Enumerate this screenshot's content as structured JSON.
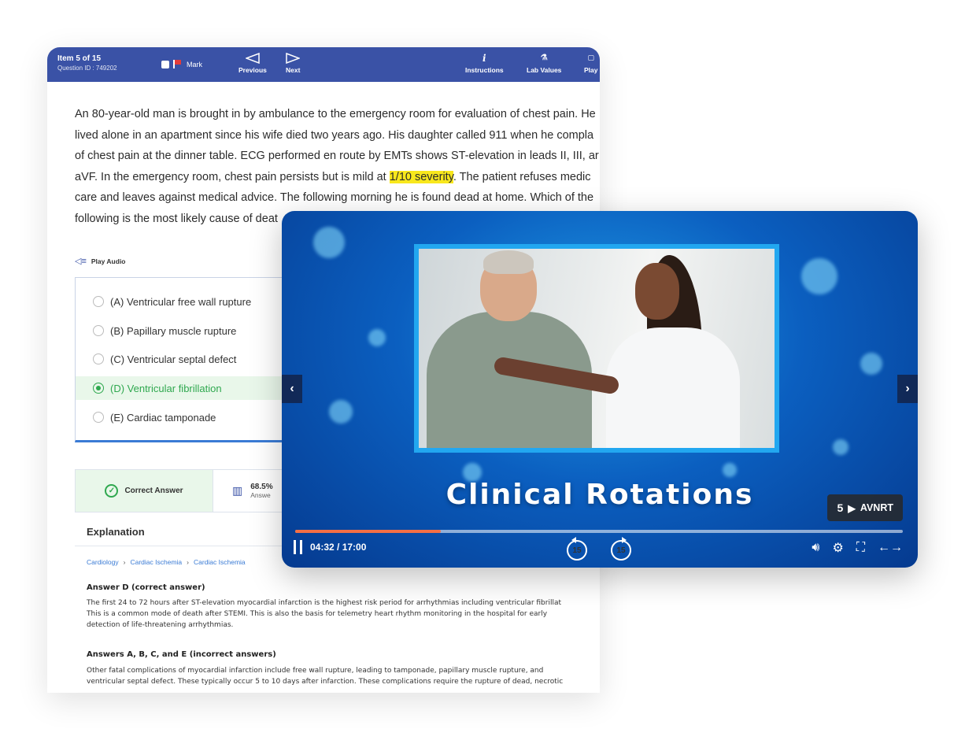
{
  "header": {
    "item": "Item 5 of 15",
    "question_id": "Question ID : 749202",
    "mark": "Mark",
    "previous": "Previous",
    "next": "Next",
    "instructions": "Instructions",
    "lab_values": "Lab Values",
    "play_truncated": "Play"
  },
  "stem": {
    "line1": "An 80-year-old man is brought in by ambulance to the emergency room for evaluation of chest pain. He",
    "line2": "lived alone in an apartment since his wife died two years ago. His daughter called 911 when he compla",
    "line3": "of chest pain at the dinner table. ECG performed en route by EMTs shows ST-elevation in leads II, III, ar",
    "line4_pre": "aVF. In the emergency room, chest pain persists but is mild at ",
    "line4_highlight": "1/10 severity",
    "line4_post": ". The patient refuses medic",
    "line5": "care and leaves against medical advice. The following morning he is found dead at home. Which of the",
    "line6": "following is the most likely cause of deat"
  },
  "play_audio": "Play Audio",
  "choices": [
    {
      "label": "(A) Ventricular free wall rupture",
      "selected": false
    },
    {
      "label": "(B) Papillary muscle rupture",
      "selected": false
    },
    {
      "label": "(C) Ventricular septal defect",
      "selected": false
    },
    {
      "label": "(D) Ventricular fibrillation",
      "selected": true
    },
    {
      "label": "(E) Cardiac tamponade",
      "selected": false
    }
  ],
  "result": {
    "correct": "Correct Answer",
    "percent": "68.5%",
    "percent_label": "Answe"
  },
  "explanation": {
    "heading": "Explanation",
    "breadcrumb": [
      "Cardiology",
      "Cardiac Ischemia",
      "Cardiac Ischemia"
    ],
    "sec1_title": "Answer D (correct answer)",
    "sec1_l1": "The first 24 to 72 hours after ST-elevation myocardial infarction is the highest risk period for arrhythmias including ventricular fibrillat",
    "sec1_l2": "This is a common mode of death after STEMI. This is also the basis for telemetry heart rhythm monitoring in the hospital for early",
    "sec1_l3": "detection of life-threatening arrhythmias.",
    "sec2_title": "Answers A, B, C, and E (incorrect answers)",
    "sec2_l1": "Other fatal complications of myocardial infarction include free wall rupture, leading to tamponade, papillary muscle rupture, and",
    "sec2_l2": "ventricular septal defect. These typically occur 5 to 10 days after infarction. These complications require the rupture of dead, necrotic"
  },
  "video": {
    "title": "Clinical Rotations",
    "chapter_num": "5",
    "chapter_name": "AVNRT",
    "time": "04:32 / 17:00",
    "progress_fraction": 0.24,
    "skip_back": "15",
    "skip_fwd": "15"
  },
  "colors": {
    "header_bg": "#3a52a6",
    "correct_green": "#2fa84f",
    "highlight": "#f8e71c",
    "progress": "#f36f45"
  }
}
